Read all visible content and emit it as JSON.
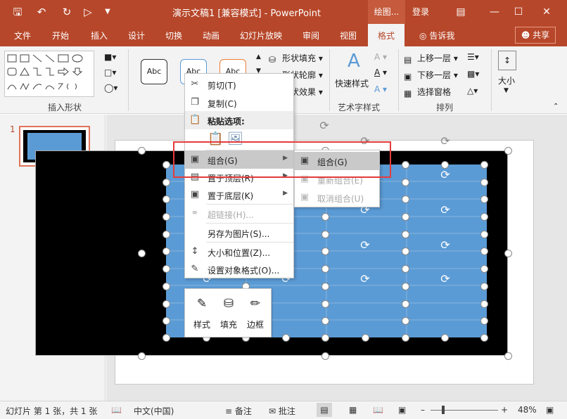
{
  "titlebar": {
    "save_icon": "save-icon",
    "undo_icon": "undo-icon",
    "redo_icon": "redo-icon",
    "present_icon": "present-icon",
    "customize_icon": "customize-qat-icon",
    "title": "演示文稿1 [兼容模式] - PowerPoint",
    "context_tab": "绘图...",
    "login": "登录",
    "brand_color": "#b7472a"
  },
  "tabs": [
    {
      "label": "文件"
    },
    {
      "label": "开始"
    },
    {
      "label": "插入"
    },
    {
      "label": "设计"
    },
    {
      "label": "切换"
    },
    {
      "label": "动画"
    },
    {
      "label": "幻灯片放映"
    },
    {
      "label": "审阅"
    },
    {
      "label": "视图"
    },
    {
      "label": "格式"
    }
  ],
  "tellme": "告诉我",
  "share": "共享",
  "ribbon": {
    "insert_shapes_label": "插入形状",
    "style_abc": "Abc",
    "shape_fill": "形状填充",
    "shape_outline": "形状轮廓",
    "shape_effects": "形状效果",
    "quick_styles": "快速样式",
    "wordart_label": "艺术字样式",
    "bring_forward": "上移一层",
    "send_backward": "下移一层",
    "selection_pane": "选择窗格",
    "arrange_label": "排列",
    "size": "大小"
  },
  "thumbs": {
    "slide_number": "1"
  },
  "context_menu": {
    "items": [
      {
        "label": "剪切(T)"
      },
      {
        "label": "复制(C)"
      },
      {
        "label": "粘贴选项:"
      },
      {
        "label": "组合(G)"
      },
      {
        "label": "置于顶层(R)"
      },
      {
        "label": "置于底层(K)"
      },
      {
        "label": "超链接(H)..."
      },
      {
        "label": "另存为图片(S)..."
      },
      {
        "label": "大小和位置(Z)..."
      },
      {
        "label": "设置对象格式(O)..."
      }
    ]
  },
  "submenu": {
    "items": [
      {
        "label": "组合(G)"
      },
      {
        "label": "重新组合(E)"
      },
      {
        "label": "取消组合(U)"
      }
    ]
  },
  "mini_toolbar": {
    "style": "样式",
    "fill": "填充",
    "outline": "边框"
  },
  "status": {
    "slide_info": "幻灯片 第 1 张，共 1 张",
    "language": "中文(中国)",
    "notes": "备注",
    "comments": "批注",
    "zoom": "48%"
  },
  "colors": {
    "table_fill": "#5b9bd5",
    "highlight": "#e53b3b"
  }
}
